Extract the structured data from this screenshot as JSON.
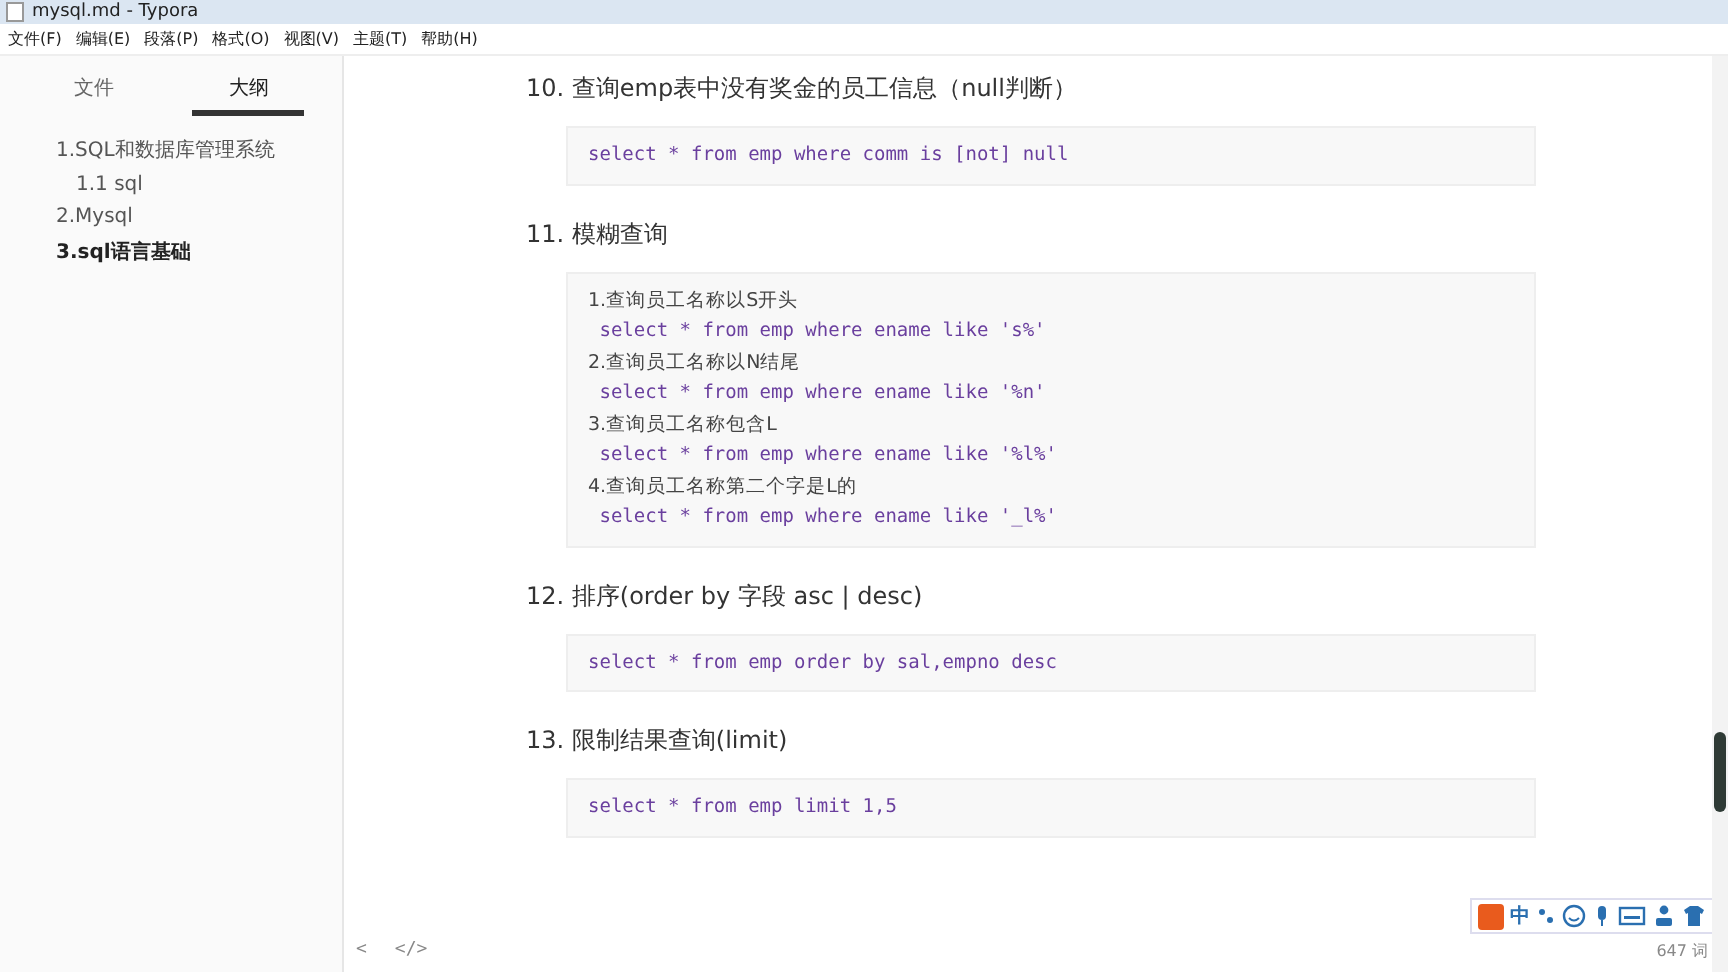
{
  "window": {
    "title": "mysql.md - Typora"
  },
  "menu": [
    "文件(F)",
    "编辑(E)",
    "段落(P)",
    "格式(O)",
    "视图(V)",
    "主题(T)",
    "帮助(H)"
  ],
  "sidebar": {
    "tabs": [
      {
        "label": "文件",
        "selected": false
      },
      {
        "label": "大纲",
        "selected": true
      }
    ],
    "outline": [
      {
        "label": "1.SQL和数据库管理系统",
        "selected": false,
        "children": [
          {
            "label": "1.1 sql",
            "selected": false
          }
        ]
      },
      {
        "label": "2.Mysql",
        "selected": false
      },
      {
        "label": "3.sql语言基础",
        "selected": true
      }
    ]
  },
  "sections": [
    {
      "heading": "10. 查询emp表中没有奖金的员工信息（null判断）",
      "lines": [
        {
          "kind": "code",
          "text": "select * from emp where comm is [not] null"
        }
      ]
    },
    {
      "heading": "11. 模糊查询",
      "lines": [
        {
          "kind": "text",
          "text": "1.查询员工名称以S开头"
        },
        {
          "kind": "code",
          "text": " select * from emp where ename like 's%'"
        },
        {
          "kind": "text",
          "text": "2.查询员工名称以N结尾"
        },
        {
          "kind": "code",
          "text": " select * from emp where ename like '%n'"
        },
        {
          "kind": "text",
          "text": "3.查询员工名称包含L"
        },
        {
          "kind": "code",
          "text": " select * from emp where ename like '%l%'"
        },
        {
          "kind": "text",
          "text": "4.查询员工名称第二个字是L的"
        },
        {
          "kind": "code",
          "text": " select * from emp where ename like '_l%'"
        }
      ]
    },
    {
      "heading": "12. 排序(order by 字段 asc | desc)",
      "lines": [
        {
          "kind": "code",
          "text": "select * from emp order by sal,empno desc"
        }
      ]
    },
    {
      "heading": "13. 限制结果查询(limit)",
      "lines": [
        {
          "kind": "code",
          "text": "select * from emp limit 1,5"
        }
      ]
    }
  ],
  "ime": {
    "mode": "中"
  },
  "status_bar": {
    "left": "<",
    "source": "</>",
    "word_count": "647 词"
  }
}
